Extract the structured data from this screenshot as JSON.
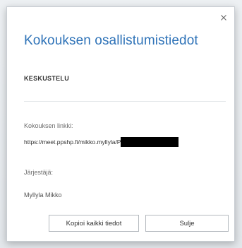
{
  "dialog": {
    "title": "Kokouksen osallistumistiedot",
    "section_heading": "KESKUSTELU",
    "meeting_link_label": "Kokouksen linkki:",
    "meeting_link_value": "https://meet.ppshp.fi/mikko.myllyla/P",
    "organizer_label": "Järjestäjä:",
    "organizer_name": "Myllyla Mikko",
    "copy_all_button": "Kopioi kaikki tiedot",
    "close_button": "Sulje"
  },
  "icons": {
    "close": "close-icon"
  },
  "colors": {
    "title": "#2f73b8",
    "redaction": "#000000"
  }
}
